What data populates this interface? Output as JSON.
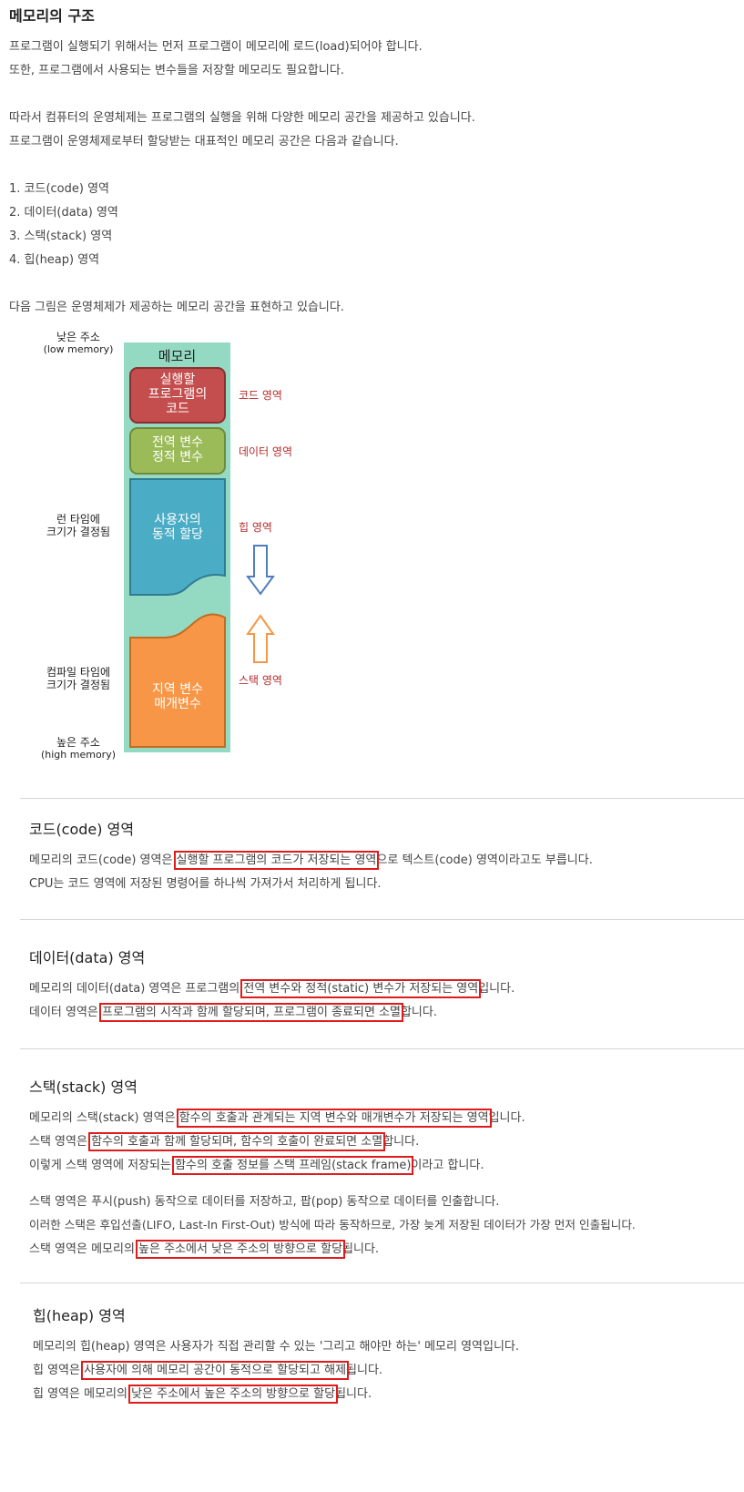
{
  "heading": "메모리의 구조",
  "intro": {
    "line1": "프로그램이 실행되기 위해서는 먼저 프로그램이 메모리에 로드(load)되어야 합니다.",
    "line2": "또한, 프로그램에서 사용되는 변수들을 저장할 메모리도 필요합니다.",
    "line3": "따라서 컴퓨터의 운영체제는 프로그램의 실행을 위해 다양한 메모리 공간을 제공하고 있습니다.",
    "line4": "프로그램이 운영체제로부터 할당받는 대표적인 메모리 공간은 다음과 같습니다.",
    "list": [
      "1. 코드(code) 영역",
      "2. 데이터(data) 영역",
      "3. 스택(stack) 영역",
      "4. 힙(heap) 영역"
    ],
    "figure_caption": "다음 그림은 운영체제가 제공하는 메모리 공간을 표현하고 있습니다."
  },
  "diagram": {
    "low_addr": "낮은 주소",
    "low_addr_en": "(low memory)",
    "runtime_1": "런 타임에",
    "runtime_2": "크기가 결정됨",
    "compile_1": "컴파일 타임에",
    "compile_2": "크기가 결정됨",
    "high_addr": "높은 주소",
    "high_addr_en": "(high memory)",
    "memory_title": "메모리",
    "code_box_1": "실행할",
    "code_box_2": "프로그램의",
    "code_box_3": "코드",
    "data_box_1": "전역 변수",
    "data_box_2": "정적 변수",
    "heap_box_1": "사용자의",
    "heap_box_2": "동적 할당",
    "stack_box_1": "지역 변수",
    "stack_box_2": "매개변수",
    "code_label": "코드 영역",
    "data_label": "데이터 영역",
    "heap_label": "힙 영역",
    "stack_label": "스택 영역",
    "colors": {
      "bg": "#94d9c2",
      "code": "#c44d4d",
      "data": "#9bbb59",
      "heap": "#4bacc6",
      "stack": "#f79646",
      "down_arrow": "#4f7dc0",
      "up_arrow": "#f79646",
      "highlight": "#e01b1b"
    }
  },
  "code_section": {
    "title": "코드(code) 영역",
    "l1_a": "메모리의 코드(code) 영역은 ",
    "l1_hl": "실행할 프로그램의 코드가 저장되는 영역",
    "l1_b": "으로 텍스트(code) 영역이라고도 부릅니다.",
    "l2": "CPU는 코드 영역에 저장된 명령어를 하나씩 가져가서 처리하게 됩니다."
  },
  "data_section": {
    "title": "데이터(data) 영역",
    "l1_a": "메모리의 데이터(data) 영역은 프로그램의 ",
    "l1_hl": "전역 변수와 정적(static) 변수가 저장되는 영역",
    "l1_b": "입니다.",
    "l2_a": "데이터 영역은 ",
    "l2_hl": "프로그램의 시작과 함께 할당되며, 프로그램이 종료되면 소멸",
    "l2_b": "합니다."
  },
  "stack_section": {
    "title": "스택(stack) 영역",
    "l1_a": "메모리의 스택(stack) 영역은 ",
    "l1_hl": "함수의 호출과 관계되는 지역 변수와 매개변수가 저장되는 영역",
    "l1_b": "입니다.",
    "l2_a": "스택 영역은 ",
    "l2_hl": "함수의 호출과 함께 할당되며, 함수의 호출이 완료되면 소멸",
    "l2_b": "합니다.",
    "l3_a": "이렇게 스택 영역에 저장되는 ",
    "l3_hl": "함수의 호출 정보를 스택 프레임(stack frame)",
    "l3_b": "이라고 합니다.",
    "l4": "스택 영역은 푸시(push) 동작으로 데이터를 저장하고, 팝(pop) 동작으로 데이터를 인출합니다.",
    "l5": "이러한 스택은 후입선출(LIFO, Last-In First-Out) 방식에 따라 동작하므로, 가장 늦게 저장된 데이터가 가장 먼저 인출됩니다.",
    "l6_a": "스택 영역은 메모리의 ",
    "l6_hl": "높은 주소에서 낮은 주소의 방향으로 할당",
    "l6_b": "됩니다."
  },
  "heap_section": {
    "title": "힙(heap) 영역",
    "l1": "메모리의 힙(heap) 영역은 사용자가 직접 관리할 수 있는 '그리고 해야만 하는' 메모리 영역입니다.",
    "l2_a": "힙 영역은 ",
    "l2_hl": "사용자에 의해 메모리 공간이 동적으로 할당되고 해제",
    "l2_b": "됩니다.",
    "l3_a": "힙 영역은 메모리의 ",
    "l3_hl": "낮은 주소에서 높은 주소의 방향으로 할당",
    "l3_b": "됩니다."
  }
}
